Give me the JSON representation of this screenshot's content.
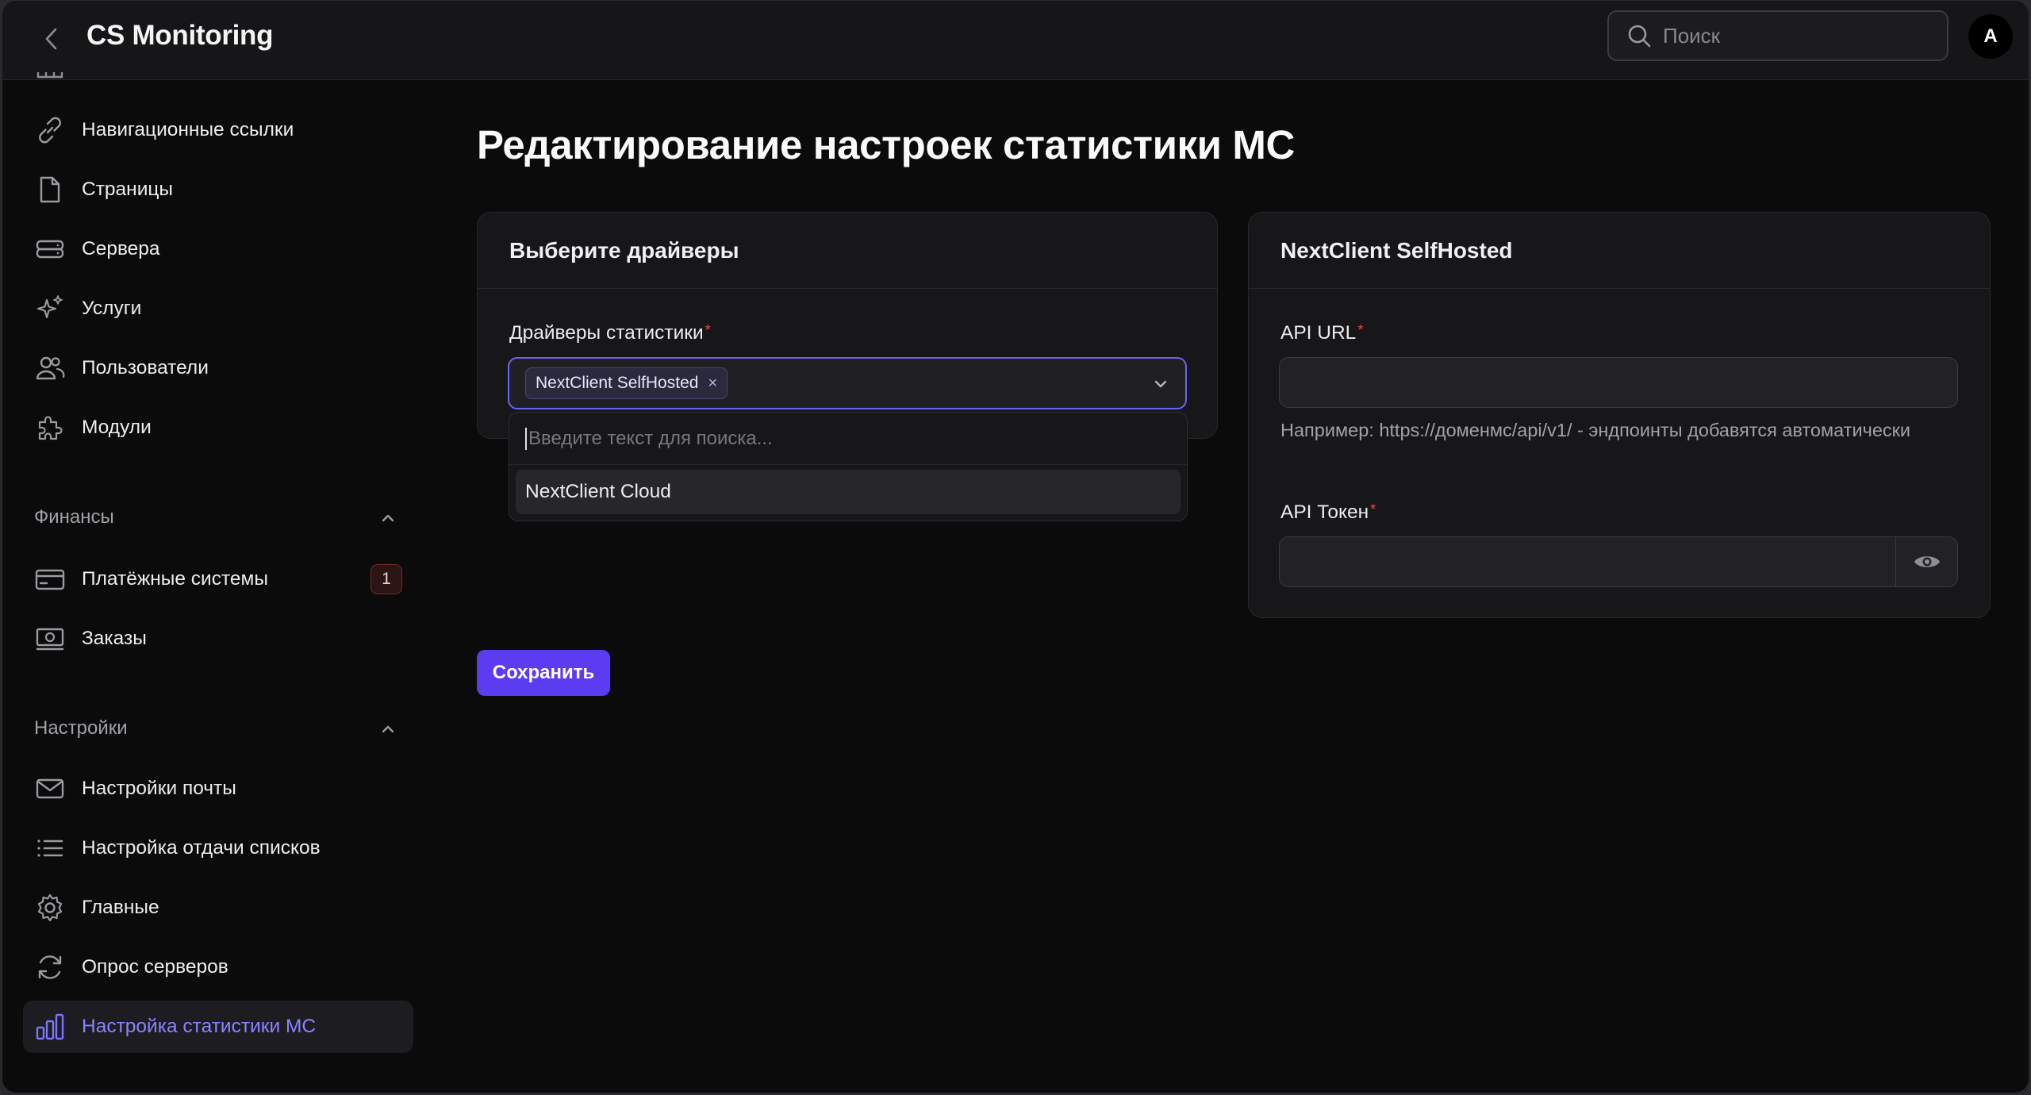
{
  "app": {
    "title": "CS Monitoring",
    "avatar_letter": "A"
  },
  "search": {
    "placeholder": "Поиск"
  },
  "sidebar": {
    "items": [
      {
        "label": "Навигационные ссылки",
        "icon": "link-icon"
      },
      {
        "label": "Страницы",
        "icon": "document-icon"
      },
      {
        "label": "Сервера",
        "icon": "server-icon"
      },
      {
        "label": "Услуги",
        "icon": "sparkles-icon"
      },
      {
        "label": "Пользователи",
        "icon": "users-icon"
      },
      {
        "label": "Модули",
        "icon": "puzzle-icon"
      }
    ],
    "groups": [
      {
        "title": "Финансы",
        "items": [
          {
            "label": "Платёжные системы",
            "icon": "credit-card-icon",
            "badge": "1"
          },
          {
            "label": "Заказы",
            "icon": "cash-icon"
          }
        ]
      },
      {
        "title": "Настройки",
        "items": [
          {
            "label": "Настройки почты",
            "icon": "envelope-icon"
          },
          {
            "label": "Настройка отдачи списков",
            "icon": "list-icon"
          },
          {
            "label": "Главные",
            "icon": "gear-icon"
          },
          {
            "label": "Опрос серверов",
            "icon": "refresh-icon"
          },
          {
            "label": "Настройка статистики МС",
            "icon": "chart-bar-icon",
            "active": true
          }
        ]
      }
    ]
  },
  "main": {
    "title": "Редактирование настроек статистики МС",
    "drivers_card": {
      "heading": "Выберите драйверы",
      "field_label": "Драйверы статистики",
      "selected_chip": "NextClient SelfHosted",
      "dropdown": {
        "search_placeholder": "Введите текст для поиска...",
        "options": [
          "NextClient Cloud"
        ]
      }
    },
    "selfhosted_card": {
      "heading": "NextClient SelfHosted",
      "api_url_label": "API URL",
      "api_url_value": "",
      "api_url_hint": "Например: https://доменмс/api/v1/ - эндпоинты добавятся автоматически",
      "api_token_label": "API Токен",
      "api_token_value": ""
    },
    "save_label": "Сохранить"
  },
  "colors": {
    "accent": "#5b3cf0",
    "accent_text": "#8b83ff",
    "required": "#ef4444"
  }
}
